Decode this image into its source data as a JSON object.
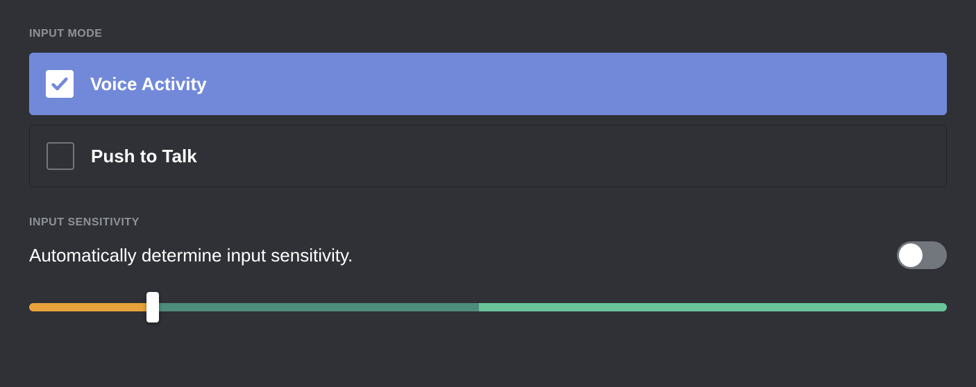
{
  "input_mode": {
    "header": "INPUT MODE",
    "options": [
      {
        "label": "Voice Activity",
        "selected": true
      },
      {
        "label": "Push to Talk",
        "selected": false
      }
    ]
  },
  "input_sensitivity": {
    "header": "INPUT SENSITIVITY",
    "auto_label": "Automatically determine input sensitivity.",
    "auto_enabled": false,
    "slider": {
      "threshold_percent": 13.5,
      "segments": {
        "orange_percent": 13.5,
        "dark_green_percent": 35.5,
        "light_green_percent": 51
      },
      "colors": {
        "orange": "#e8a23b",
        "dark_green": "#4e8d7c",
        "light_green": "#69c49a"
      }
    }
  }
}
